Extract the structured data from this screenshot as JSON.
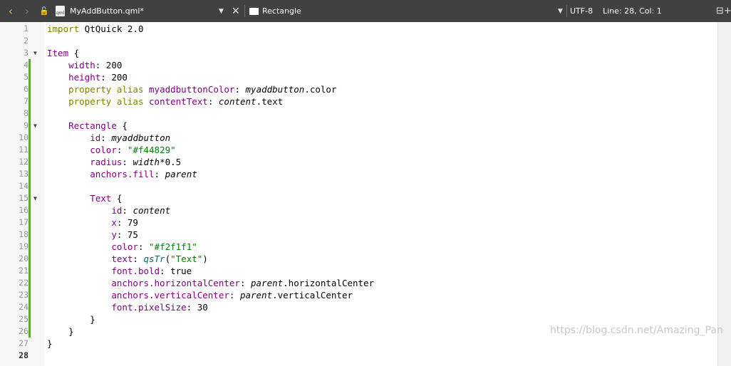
{
  "toolbar": {
    "back_icon": "chevron-left",
    "forward_icon": "chevron-right",
    "lock_icon": "lock",
    "file_icon_label": "qml",
    "file_name": "MyAddButton.qml*",
    "combo_arrow": "▼",
    "close_icon": "✕",
    "symbol_name": "Rectangle",
    "encoding": "UTF-8",
    "cursor_position": "Line: 28, Col: 1",
    "split_icon": "⊟+",
    "accent_color": "#e8b030"
  },
  "editor": {
    "current_line": 28,
    "lines": [
      {
        "n": "1",
        "text": "import QtQuick 2.0"
      },
      {
        "n": "2",
        "text": ""
      },
      {
        "n": "3",
        "text": "Item {",
        "fold": true
      },
      {
        "n": "4",
        "text": "    width: 200",
        "changed": true
      },
      {
        "n": "5",
        "text": "    height: 200",
        "changed": true
      },
      {
        "n": "6",
        "text": "    property alias myaddbuttonColor: myaddbutton.color",
        "changed": true
      },
      {
        "n": "7",
        "text": "    property alias contentText: content.text",
        "changed": true
      },
      {
        "n": "8",
        "text": "",
        "changed": true
      },
      {
        "n": "9",
        "text": "    Rectangle {",
        "fold": true,
        "changed": true
      },
      {
        "n": "10",
        "text": "        id: myaddbutton",
        "changed": true
      },
      {
        "n": "11",
        "text": "        color: \"#f44829\"",
        "changed": true
      },
      {
        "n": "12",
        "text": "        radius: width*0.5",
        "changed": true
      },
      {
        "n": "13",
        "text": "        anchors.fill: parent",
        "changed": true
      },
      {
        "n": "14",
        "text": "",
        "changed": true
      },
      {
        "n": "15",
        "text": "        Text {",
        "fold": true,
        "changed": true
      },
      {
        "n": "16",
        "text": "            id: content",
        "changed": true
      },
      {
        "n": "17",
        "text": "            x: 79",
        "changed": true
      },
      {
        "n": "18",
        "text": "            y: 75",
        "changed": true
      },
      {
        "n": "19",
        "text": "            color: \"#f2f1f1\"",
        "changed": true
      },
      {
        "n": "20",
        "text": "            text: qsTr(\"Text\")",
        "changed": true
      },
      {
        "n": "21",
        "text": "            font.bold: true",
        "changed": true
      },
      {
        "n": "22",
        "text": "            anchors.horizontalCenter: parent.horizontalCenter",
        "changed": true
      },
      {
        "n": "23",
        "text": "            anchors.verticalCenter: parent.verticalCenter",
        "changed": true
      },
      {
        "n": "24",
        "text": "            font.pixelSize: 30",
        "changed": true
      },
      {
        "n": "25",
        "text": "        }",
        "changed": true
      },
      {
        "n": "26",
        "text": "    }",
        "changed": true
      },
      {
        "n": "27",
        "text": "}"
      },
      {
        "n": "28",
        "text": ""
      }
    ]
  },
  "watermark": "https://blog.csdn.net/Amazing_Pan",
  "colors": {
    "keyword": "#808000",
    "type": "#800080",
    "string": "#008000",
    "change_marker": "#5aa73a"
  }
}
